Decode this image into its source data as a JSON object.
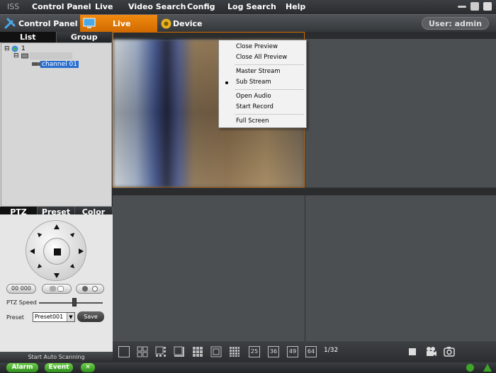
{
  "menubar": {
    "brand": "ISS",
    "items": [
      "Control Panel",
      "Live",
      "Video Search",
      "Config",
      "Log Search",
      "Help"
    ]
  },
  "toolbar": {
    "control_panel": "Control Panel",
    "live": "Live",
    "device_manage": "Device Manage",
    "user": "User: admin"
  },
  "left_panel": {
    "tabs": [
      "List",
      "Group"
    ],
    "tree": {
      "root": "1",
      "channel": "channel 01"
    }
  },
  "ptz_panel": {
    "tabs": [
      "PTZ",
      "Preset",
      "Color"
    ],
    "zoom_label": "00 000",
    "ptz_speed_label": "PTZ Speed",
    "ptz_speed_value": 0.55,
    "preset_label": "Preset",
    "preset_value": "Preset001",
    "save_label": "Save",
    "auto_scan_label": "Start Auto Scanning"
  },
  "context_menu": {
    "items": [
      "Close Preview",
      "Close All Preview",
      "Master Stream",
      "Sub Stream",
      "Open Audio",
      "Start Record",
      "Full Screen"
    ],
    "selected": "Sub Stream"
  },
  "bottom_bar": {
    "layout_labels": [
      "25",
      "36",
      "49",
      "64"
    ],
    "page_indicator": "1/32"
  },
  "status_bar": {
    "alarm": "Alarm",
    "event": "Event"
  },
  "colors": {
    "accent": "#e07a00",
    "status_green": "#3fa52a",
    "selection_blue": "#2a6fd0"
  }
}
